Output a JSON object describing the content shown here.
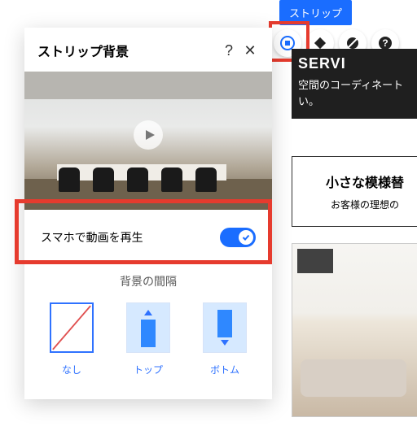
{
  "toolbar": {
    "strip_label": "ストリップ"
  },
  "panel": {
    "title": "ストリップ背景",
    "help": "?",
    "close": "✕",
    "toggle_label": "スマホで動画を再生",
    "spacing_head": "背景の間隔",
    "opts": {
      "none": "なし",
      "top": "トップ",
      "bottom": "ボトム"
    }
  },
  "right": {
    "hero_title": "SERVI",
    "hero_sub_1": "空間のコーディネート",
    "hero_sub_2": "い。",
    "block_title": "小さな模様替",
    "block_sub": "お客様の理想の"
  }
}
